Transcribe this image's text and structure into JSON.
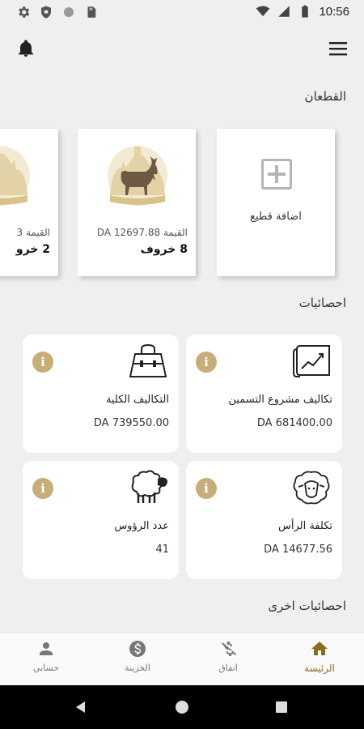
{
  "status_bar": {
    "time": "10:56",
    "left_icons": [
      "gear-icon",
      "shield-icon",
      "circle-icon",
      "sdcard-icon"
    ],
    "right_icons": [
      "wifi-icon",
      "signal-icon",
      "battery-icon"
    ]
  },
  "app_bar": {
    "left_icon": "bell-icon",
    "right_icon": "menu-icon"
  },
  "herds": {
    "title": "القطعان",
    "add_label": "اضافة قطيع",
    "cards": [
      {
        "value": "القيمة DA 12697.88",
        "count": "8 خروف"
      },
      {
        "value": "القيمة 3",
        "count": "2 خرو"
      }
    ]
  },
  "stats": {
    "title": "احصائيات",
    "cards": [
      {
        "label": "تكاليف مشروع التسمين",
        "value": "DA 681400.00",
        "icon": "chart-scroll-icon"
      },
      {
        "label": "التكاليف الكلية",
        "value": "DA 739550.00",
        "icon": "handbag-icon"
      },
      {
        "label": "تكلفة الرأس",
        "value": "DA 14677.56",
        "icon": "sheep-head-icon"
      },
      {
        "label": "عدد الرؤوس",
        "value": "41",
        "icon": "sheep-icon"
      }
    ],
    "info_glyph": "i"
  },
  "other_stats": {
    "title": "احصائيات اخرى"
  },
  "bottom_nav": {
    "items": [
      {
        "label": "الرئيسة",
        "icon": "home-icon",
        "active": true
      },
      {
        "label": "انفاق",
        "icon": "no-money-icon",
        "active": false
      },
      {
        "label": "الخزينة",
        "icon": "dollar-coin-icon",
        "active": false
      },
      {
        "label": "حسابي",
        "icon": "person-icon",
        "active": false
      }
    ]
  },
  "colors": {
    "accent": "#8a6e1e",
    "info": "#c8ad78",
    "background": "#efefef"
  }
}
